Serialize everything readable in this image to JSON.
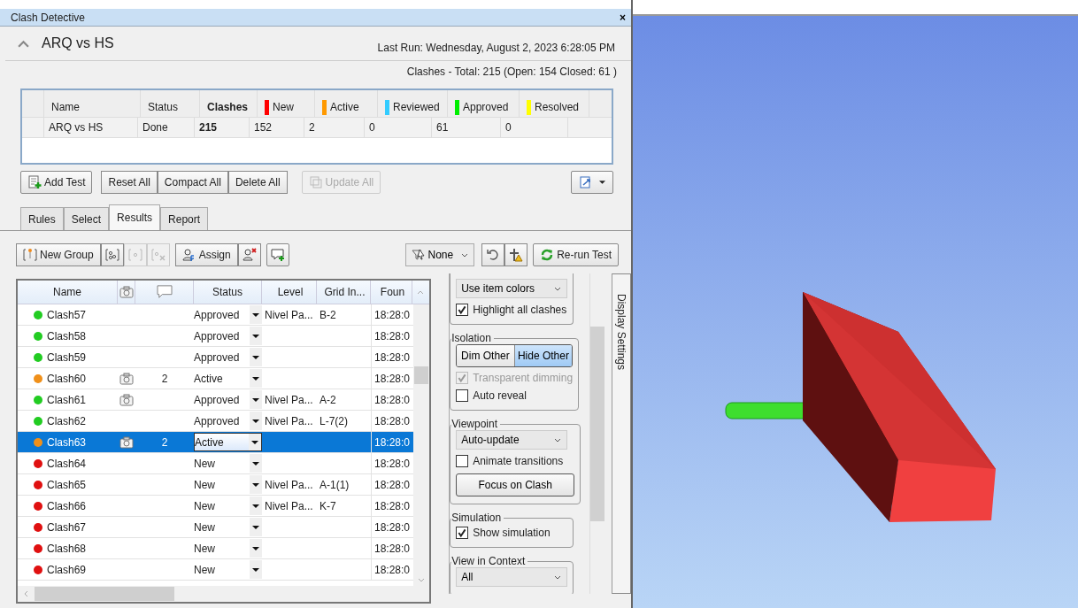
{
  "window": {
    "title": "Clash Detective",
    "close": "×"
  },
  "test": {
    "title": "ARQ vs HS",
    "last_run": "Last Run:  Wednesday, August 2, 2023 6:28:05 PM",
    "counts": "Clashes -  Total:  215  (Open:  154  Closed:  61 )"
  },
  "summary_table": {
    "columns": [
      {
        "label": "Name",
        "bold": false
      },
      {
        "label": "Status",
        "bold": false
      },
      {
        "label": "Clashes",
        "bold": true
      },
      {
        "label": "New",
        "bold": false,
        "color": "#ff0000"
      },
      {
        "label": "Active",
        "bold": false,
        "color": "#ff9900"
      },
      {
        "label": "Reviewed",
        "bold": false,
        "color": "#33ccff"
      },
      {
        "label": "Approved",
        "bold": false,
        "color": "#00ee00"
      },
      {
        "label": "Resolved",
        "bold": false,
        "color": "#ffff00"
      }
    ],
    "rows": [
      {
        "cells": [
          "ARQ vs HS",
          "Done",
          "215",
          "152",
          "2",
          "0",
          "61",
          "0"
        ]
      }
    ]
  },
  "test_buttons": [
    {
      "label": "Add Test",
      "disabled": false
    },
    {
      "label": "Reset All",
      "disabled": false
    },
    {
      "label": "Compact All",
      "disabled": false
    },
    {
      "label": "Delete All",
      "disabled": false
    },
    {
      "label": "Update All",
      "disabled": true
    }
  ],
  "tabs": [
    {
      "label": "Rules",
      "selected": false
    },
    {
      "label": "Select",
      "selected": false
    },
    {
      "label": "Results",
      "selected": true
    },
    {
      "label": "Report",
      "selected": false
    }
  ],
  "toolbar": {
    "new_group": "New Group",
    "assign": "Assign",
    "filter": "None",
    "rerun": "Re-run Test"
  },
  "results": {
    "columns": [
      {
        "label": "Name",
        "kind": "text"
      },
      {
        "kind": "camera"
      },
      {
        "kind": "comment"
      },
      {
        "label": "Status",
        "kind": "text"
      },
      {
        "label": "Level",
        "kind": "text"
      },
      {
        "label": "Grid In...",
        "kind": "text"
      },
      {
        "label": "Foun",
        "kind": "text"
      }
    ],
    "rows": [
      {
        "name": "Clash57",
        "color": "#22cc22",
        "viewpoint": false,
        "comments": "",
        "status": "Approved",
        "level": "Nivel Pa...",
        "grid": "B-2",
        "found": "18:28:0",
        "selected": false
      },
      {
        "name": "Clash58",
        "color": "#22cc22",
        "viewpoint": false,
        "comments": "",
        "status": "Approved",
        "level": "",
        "grid": "",
        "found": "18:28:0",
        "selected": false
      },
      {
        "name": "Clash59",
        "color": "#22cc22",
        "viewpoint": false,
        "comments": "",
        "status": "Approved",
        "level": "",
        "grid": "",
        "found": "18:28:0",
        "selected": false
      },
      {
        "name": "Clash60",
        "color": "#f0901a",
        "viewpoint": true,
        "comments": "2",
        "status": "Active",
        "level": "",
        "grid": "",
        "found": "18:28:0",
        "selected": false
      },
      {
        "name": "Clash61",
        "color": "#22cc22",
        "viewpoint": true,
        "comments": "",
        "status": "Approved",
        "level": "Nivel Pa...",
        "grid": "A-2",
        "found": "18:28:0",
        "selected": false
      },
      {
        "name": "Clash62",
        "color": "#22cc22",
        "viewpoint": false,
        "comments": "",
        "status": "Approved",
        "level": "Nivel Pa...",
        "grid": "L-7(2)",
        "found": "18:28:0",
        "selected": false
      },
      {
        "name": "Clash63",
        "color": "#f0901a",
        "viewpoint": true,
        "comments": "2",
        "status": "Active",
        "level": "",
        "grid": "",
        "found": "18:28:0",
        "selected": true
      },
      {
        "name": "Clash64",
        "color": "#e01010",
        "viewpoint": false,
        "comments": "",
        "status": "New",
        "level": "",
        "grid": "",
        "found": "18:28:0",
        "selected": false
      },
      {
        "name": "Clash65",
        "color": "#e01010",
        "viewpoint": false,
        "comments": "",
        "status": "New",
        "level": "Nivel Pa...",
        "grid": "A-1(1)",
        "found": "18:28:0",
        "selected": false
      },
      {
        "name": "Clash66",
        "color": "#e01010",
        "viewpoint": false,
        "comments": "",
        "status": "New",
        "level": "Nivel Pa...",
        "grid": "K-7",
        "found": "18:28:0",
        "selected": false
      },
      {
        "name": "Clash67",
        "color": "#e01010",
        "viewpoint": false,
        "comments": "",
        "status": "New",
        "level": "",
        "grid": "",
        "found": "18:28:0",
        "selected": false
      },
      {
        "name": "Clash68",
        "color": "#e01010",
        "viewpoint": false,
        "comments": "",
        "status": "New",
        "level": "",
        "grid": "",
        "found": "18:28:0",
        "selected": false
      },
      {
        "name": "Clash69",
        "color": "#e01010",
        "viewpoint": false,
        "comments": "",
        "status": "New",
        "level": "",
        "grid": "",
        "found": "18:28:0",
        "selected": false
      }
    ]
  },
  "display_settings": {
    "tab": "Display Settings",
    "highlight_mode": "Use item colors",
    "highlight_all": {
      "label": "Highlight all clashes",
      "checked": true
    },
    "isolation": {
      "title": "Isolation",
      "options": [
        {
          "label": "Dim Other",
          "selected": false
        },
        {
          "label": "Hide Other",
          "selected": true
        }
      ],
      "transparent": {
        "label": "Transparent dimming",
        "checked": true,
        "disabled": true
      },
      "auto_reveal": {
        "label": "Auto reveal",
        "checked": false,
        "disabled": false
      }
    },
    "viewpoint": {
      "title": "Viewpoint",
      "mode": "Auto-update",
      "animate": {
        "label": "Animate transitions",
        "checked": false
      },
      "focus": "Focus on Clash"
    },
    "simulation": {
      "title": "Simulation",
      "show": {
        "label": "Show simulation",
        "checked": true
      }
    },
    "context": {
      "title": "View in Context",
      "mode": "All"
    }
  }
}
